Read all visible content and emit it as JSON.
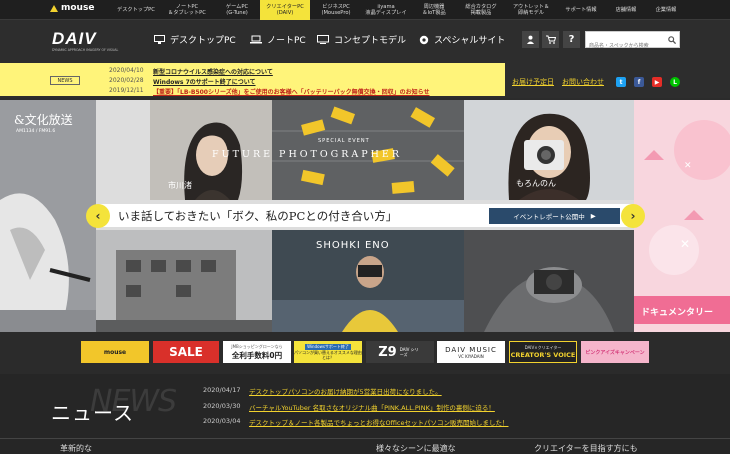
{
  "topbar": {
    "brand": "mouse",
    "nav": [
      {
        "line1": "デスクトップPC",
        "line2": ""
      },
      {
        "line1": "ノートPC",
        "line2": "＆タブレットPC"
      },
      {
        "line1": "ゲームPC",
        "line2": "(G-Tune)"
      },
      {
        "line1": "クリエイターPC",
        "line2": "(DAIV)"
      },
      {
        "line1": "ビジネスPC",
        "line2": "(MousePro)"
      },
      {
        "line1": "iiyama",
        "line2": "液晶ディスプレイ"
      },
      {
        "line1": "周辺機器",
        "line2": "＆IoT製品"
      },
      {
        "line1": "総合カタログ",
        "line2": "掲載製品"
      },
      {
        "line1": "アウトレット＆",
        "line2": "即納モデル"
      },
      {
        "line1": "サポート情報",
        "line2": ""
      },
      {
        "line1": "店舗情報",
        "line2": ""
      },
      {
        "line1": "企業情報",
        "line2": ""
      }
    ]
  },
  "mainbar": {
    "logo": "DAIV",
    "logo_sub": "DYNAMIC APPROACH IMAGERY OF VISUAL",
    "nav": [
      {
        "label": "デスクトップPC",
        "icon": "monitor-icon"
      },
      {
        "label": "ノートPC",
        "icon": "laptop-icon"
      },
      {
        "label": "コンセプトモデル",
        "icon": "display-icon"
      },
      {
        "label": "スペシャルサイト",
        "icon": "gear-icon"
      }
    ],
    "help": "?",
    "search_placeholder": "商品名・スペックから検索"
  },
  "newsbar": {
    "badge": "NEWS",
    "items": [
      {
        "date": "2020/04/10",
        "text": "新型コロナウイルス感染症への対応について",
        "red": false
      },
      {
        "date": "2020/02/28",
        "text": "Windows 7のサポート終了について",
        "red": false
      },
      {
        "date": "2019/12/11",
        "text": "【重要】「LB-B500シリーズ他」をご使用のお客様へ「バッテリーパック無償交換・回収」のお知らせ",
        "red": true
      }
    ],
    "links": [
      "お届け予定日",
      "お問い合わせ"
    ]
  },
  "hero": {
    "left_logo": "&文化放送",
    "left_logo_sub": "AM1134 / FM91.6",
    "special_event": "SPECIAL EVENT",
    "future": "FUTURE PHOTOGRAPHER",
    "name1": "市川渚",
    "name2": "もろんのん",
    "name3": "SHOHKI ENO",
    "banner_text": "いま話しておきたい「ボク、私のPCとの付き合い方」",
    "event_btn": "イベントレポート公開中",
    "right_caption": "ドキュメンタリー"
  },
  "banners": [
    {
      "text": "mouse"
    },
    {
      "text": "SALE"
    },
    {
      "text": "全利手数料0円",
      "sub": "JMBショッピングローンなら"
    },
    {
      "text": "パソコンが買い替えるオススメな理由とは？",
      "sub": "Windowsサポート終了"
    },
    {
      "text": "Z9",
      "sub": "DAIV シリーズ"
    },
    {
      "text": "DAIV MUSIC",
      "sub": "VC KIYADAIN"
    },
    {
      "text": "CREATOR'S VOICE",
      "sub": "DAIV×クリエイター"
    },
    {
      "text": "ピンクアイズキャンペーン"
    }
  ],
  "news": {
    "title": "ニュース",
    "watermark": "NEWS",
    "items": [
      {
        "date": "2020/04/17",
        "text": "デスクトップパソコンのお届け納期が5営業日出荷になりました。"
      },
      {
        "date": "2020/03/30",
        "text": "バーチャルYouTuber 名取さなオリジナル曲「PINK.ALL.PINK」制作の裏側に迫る！"
      },
      {
        "date": "2020/03/04",
        "text": "デスクトップ＆ノート各製品でちょっとお得なOfficeセットパソコン販売開始しました！"
      }
    ]
  },
  "categories": [
    "革新的な",
    "様々なシーンに最適な",
    "クリエイターを目指す方にも"
  ]
}
